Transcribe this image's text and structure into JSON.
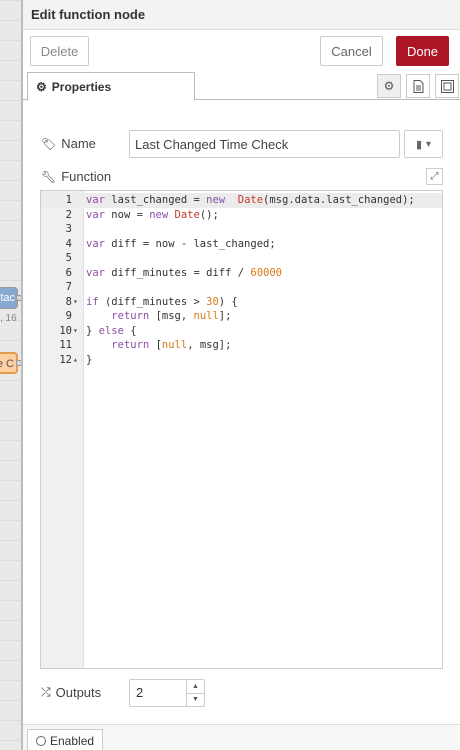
{
  "workspace": {
    "node1_label": "ntac",
    "node1_sub": ", 16",
    "node2_label": "e C"
  },
  "tray": {
    "title": "Edit function node",
    "delete_label": "Delete",
    "cancel_label": "Cancel",
    "done_label": "Done",
    "done_color": "#ad1625",
    "tab_properties": "Properties"
  },
  "form": {
    "name_label": "Name",
    "name_value": "Last Changed Time Check",
    "function_label": "Function",
    "outputs_label": "Outputs",
    "outputs_value": "2"
  },
  "code": [
    {
      "n": "1",
      "fold": "",
      "tokens": [
        [
          "kw",
          "var"
        ],
        [
          "",
          "last_changed = "
        ],
        [
          "kw",
          "new"
        ],
        [
          "",
          ""
        ],
        [
          "fn",
          " Date"
        ],
        [
          "",
          "(msg.data.last_changed);"
        ]
      ]
    },
    {
      "n": "2",
      "fold": "",
      "tokens": [
        [
          "kw",
          "var"
        ],
        [
          "",
          "now = "
        ],
        [
          "kw",
          "new"
        ],
        [
          "fn",
          " Date"
        ],
        [
          "",
          "();"
        ]
      ]
    },
    {
      "n": "3",
      "fold": "",
      "tokens": []
    },
    {
      "n": "4",
      "fold": "",
      "tokens": [
        [
          "kw",
          "var"
        ],
        [
          "",
          "diff = now - last_changed;"
        ]
      ]
    },
    {
      "n": "5",
      "fold": "",
      "tokens": []
    },
    {
      "n": "6",
      "fold": "",
      "tokens": [
        [
          "kw",
          "var"
        ],
        [
          "",
          "diff_minutes = diff / "
        ],
        [
          "num",
          "60000"
        ]
      ]
    },
    {
      "n": "7",
      "fold": "",
      "tokens": []
    },
    {
      "n": "8",
      "fold": "▾",
      "tokens": [
        [
          "kw",
          "if"
        ],
        [
          "",
          "(diff_minutes > "
        ],
        [
          "num",
          "30"
        ],
        [
          "",
          ") {"
        ]
      ]
    },
    {
      "n": "9",
      "fold": "",
      "tokens": [
        [
          "",
          "    "
        ],
        [
          "kw",
          "return"
        ],
        [
          "",
          ""
        ],
        [
          "",
          "[msg, "
        ],
        [
          "num",
          "null"
        ],
        [
          "",
          "];"
        ]
      ]
    },
    {
      "n": "10",
      "fold": "▾",
      "tokens": [
        [
          "",
          "} "
        ],
        [
          "kw",
          "else"
        ],
        [
          "",
          ""
        ],
        [
          "",
          "{"
        ]
      ]
    },
    {
      "n": "11",
      "fold": "",
      "tokens": [
        [
          "",
          "    "
        ],
        [
          "kw",
          "return"
        ],
        [
          "",
          ""
        ],
        [
          "",
          "["
        ],
        [
          "num",
          "null"
        ],
        [
          "",
          ", msg];"
        ]
      ]
    },
    {
      "n": "12",
      "fold": "▴",
      "tokens": [
        [
          "",
          "}"
        ]
      ]
    }
  ],
  "footer": {
    "enabled_label": "Enabled"
  },
  "icons": [
    "gear-icon",
    "file-icon",
    "layout-icon",
    "tag-icon",
    "wrench-icon",
    "book-icon",
    "expand-icon",
    "shuffle-icon",
    "circle-icon"
  ]
}
